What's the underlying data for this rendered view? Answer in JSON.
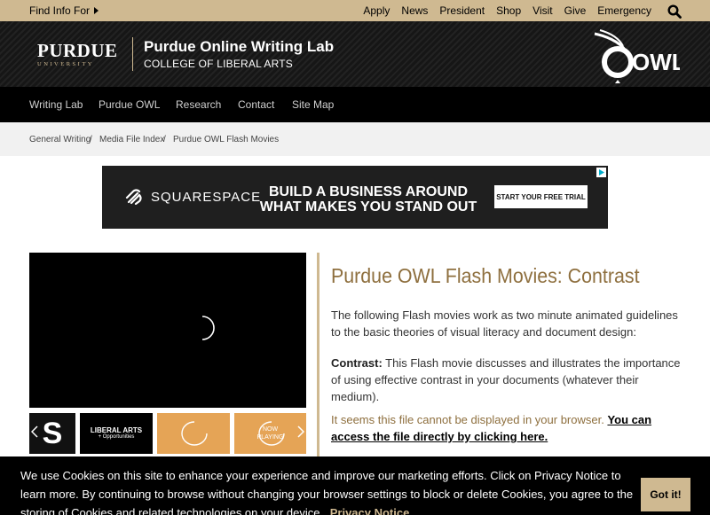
{
  "topbar": {
    "find_info": "Find Info For",
    "links": [
      "Apply",
      "News",
      "President",
      "Shop",
      "Visit",
      "Give",
      "Emergency"
    ]
  },
  "header": {
    "university_word": "PURDUE",
    "university_sub": "UNIVERSITY",
    "title": "Purdue Online Writing Lab",
    "subtitle": "COLLEGE OF LIBERAL ARTS",
    "owl_logo_text": "OWL"
  },
  "nav": {
    "items": [
      "Writing Lab",
      "Purdue OWL",
      "Research",
      "Contact",
      "Site Map"
    ]
  },
  "breadcrumb": {
    "items": [
      "General Writing",
      "Media File Index",
      "Purdue OWL Flash Movies"
    ],
    "separator": "/"
  },
  "ad": {
    "brand": "SQUARESPACE",
    "headline_line1": "BUILD A BUSINESS AROUND",
    "headline_line2": "WHAT MAKES YOU STAND OUT",
    "cta": "START YOUR FREE TRIAL"
  },
  "video": {
    "thumb1_letter": "S",
    "thumb2_line1": "LIBERAL ARTS",
    "thumb2_line2": "+ Opportunities",
    "thumb4_line1": "NOW",
    "thumb4_line2": "PLAYING"
  },
  "content": {
    "title": "Purdue OWL Flash Movies: Contrast",
    "intro": "The following Flash movies work as two minute animated guidelines to the basic theories of visual literacy and document design:",
    "contrast_label": "Contrast:",
    "contrast_text": " This Flash movie discusses and illustrates the importance of using effective contrast in your documents (whatever their medium).",
    "notice": "It seems this file cannot be displayed in your browser. ",
    "access_link": "You can access the file directly by clicking here."
  },
  "cookie": {
    "message": "We use Cookies on this site to enhance your experience and improve our marketing efforts. Click on Privacy Notice to learn more. By continuing to browse without changing your browser settings to block or delete Cookies, you agree to the storing of Cookies and related technologies on your device.",
    "privacy_link": "Privacy Notice",
    "button": "Got it!"
  },
  "colors": {
    "gold": "#cfb991",
    "dark_gold": "#8e6f3e",
    "thumb_orange": "#e5a456"
  }
}
